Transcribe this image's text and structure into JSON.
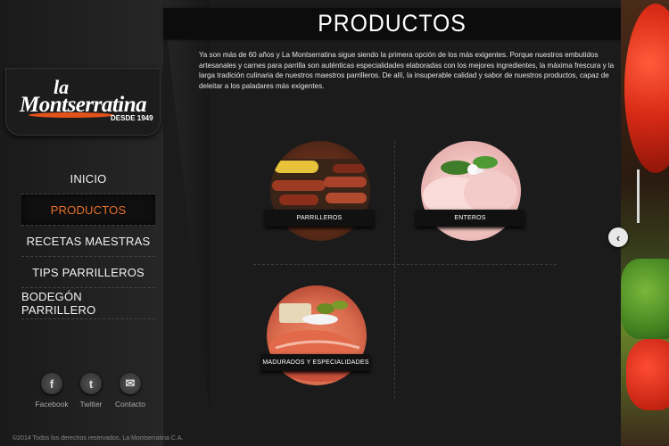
{
  "logo": {
    "line1": "la",
    "line2": "Montserratina",
    "since": "DESDE 1949"
  },
  "nav": {
    "items": [
      {
        "label": "INICIO",
        "active": false
      },
      {
        "label": "PRODUCTOS",
        "active": true
      },
      {
        "label": "RECETAS MAESTRAS",
        "active": false
      },
      {
        "label": "TIPS PARRILLEROS",
        "active": false
      },
      {
        "label": "BODEGÓN PARRILLERO",
        "active": false
      }
    ]
  },
  "social": {
    "facebook": {
      "label": "Facebook",
      "icon": "facebook-icon",
      "glyph": "f"
    },
    "twitter": {
      "label": "Twitter",
      "icon": "twitter-icon",
      "glyph": "t"
    },
    "contact": {
      "label": "Contacto",
      "icon": "mail-icon",
      "glyph": "✉"
    }
  },
  "footer": {
    "copyright": "©2014 Todos los derechos reservados. La Montserratina C.A."
  },
  "page": {
    "title": "PRODUCTOS",
    "intro": "Ya son más de 60 años y La Montserratina sigue siendo la primera opción de los más exigentes. Porque nuestros embutidos artesanales y carnes para parrilla son auténticas especialidades elaboradas con los mejores ingredientes, la máxima frescura y la larga tradición culinaria de nuestros maestros parrilleros. De allí, la insuperable calidad y sabor de nuestros productos, capaz de deleitar a los paladares más exigentes."
  },
  "categories": [
    {
      "label": "PARRILLEROS"
    },
    {
      "label": "ENTEROS"
    },
    {
      "label": "MADURADOS Y ESPECIALIDADES"
    }
  ],
  "slider": {
    "arrow_glyph": "‹"
  },
  "colors": {
    "accent": "#e8702a",
    "background": "#1b1b1b"
  }
}
